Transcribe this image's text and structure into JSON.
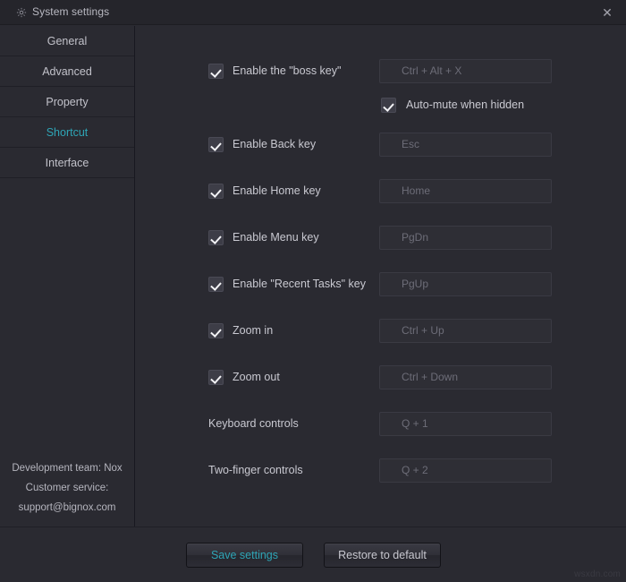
{
  "window": {
    "title": "System settings",
    "gear_icon": "gear-icon",
    "close_icon": "✕"
  },
  "sidebar": {
    "items": [
      {
        "label": "General",
        "active": false
      },
      {
        "label": "Advanced",
        "active": false
      },
      {
        "label": "Property",
        "active": false
      },
      {
        "label": "Shortcut",
        "active": true
      },
      {
        "label": "Interface",
        "active": false
      }
    ],
    "footer": {
      "line1": "Development team: Nox",
      "line2": "Customer service:",
      "line3": "support@bignox.com"
    }
  },
  "main": {
    "rows": [
      {
        "label": "Enable the \"boss key\"",
        "checkbox": true,
        "checked": true,
        "value": "Ctrl + Alt + X"
      },
      {
        "label": "Enable Back key",
        "checkbox": true,
        "checked": true,
        "value": "Esc"
      },
      {
        "label": "Enable Home key",
        "checkbox": true,
        "checked": true,
        "value": "Home"
      },
      {
        "label": "Enable Menu key",
        "checkbox": true,
        "checked": true,
        "value": "PgDn"
      },
      {
        "label": "Enable \"Recent Tasks\" key",
        "checkbox": true,
        "checked": true,
        "value": "PgUp"
      },
      {
        "label": "Zoom in",
        "checkbox": true,
        "checked": true,
        "value": "Ctrl + Up"
      },
      {
        "label": "Zoom out",
        "checkbox": true,
        "checked": true,
        "value": "Ctrl + Down"
      },
      {
        "label": "Keyboard controls",
        "checkbox": false,
        "checked": false,
        "value": "Q + 1"
      },
      {
        "label": "Two-finger controls",
        "checkbox": false,
        "checked": false,
        "value": "Q + 2"
      }
    ],
    "automute": {
      "label": "Auto-mute when hidden",
      "checked": true
    }
  },
  "buttons": {
    "save": "Save settings",
    "restore": "Restore to default"
  },
  "watermark": "wsxdn.com",
  "colors": {
    "accent": "#2ea5b6",
    "window_bg": "#2a2a31",
    "titlebar_bg": "#25252b",
    "field_bg": "#2e2e35",
    "checkbox_bg": "#3d3d47",
    "text": "#c9c9d1",
    "placeholder": "#6d6d78"
  }
}
